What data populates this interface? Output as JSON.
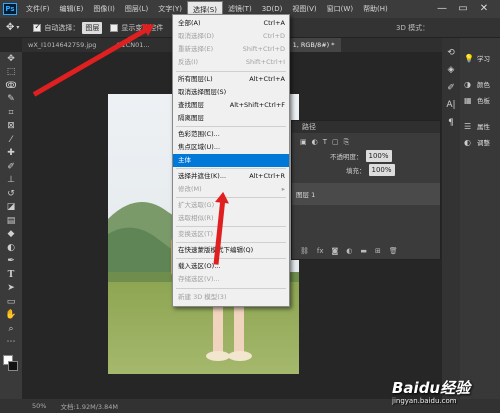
{
  "app_logo": "Ps",
  "menubar": {
    "items": [
      "文件(F)",
      "编辑(E)",
      "图像(I)",
      "图层(L)",
      "文字(Y)",
      "选择(S)",
      "滤镜(T)",
      "3D(D)",
      "视图(V)",
      "窗口(W)",
      "帮助(H)"
    ],
    "active": "选择(S)"
  },
  "window_controls": [
    "—",
    "▭",
    "✕"
  ],
  "options_bar": {
    "auto_select_label": "自动选择：",
    "auto_select_value": "图层",
    "show_transform_label": "显示变换控件",
    "right_icon_label": "3D 模式："
  },
  "tabs": [
    "wX_I1014642759.jpg",
    "O1CN01...",
    "图层 1, RGB/8#) *"
  ],
  "dropdown_menu": {
    "items": [
      {
        "label": "全部(A)",
        "shortcut": "Ctrl+A",
        "enabled": true
      },
      {
        "label": "取消选择(D)",
        "shortcut": "Ctrl+D",
        "enabled": false
      },
      {
        "label": "重新选择(E)",
        "shortcut": "Shift+Ctrl+D",
        "enabled": false
      },
      {
        "label": "反选(I)",
        "shortcut": "Shift+Ctrl+I",
        "enabled": false
      },
      {
        "label": "所有图层(L)",
        "shortcut": "Alt+Ctrl+A",
        "enabled": true
      },
      {
        "label": "取消选择图层(S)",
        "shortcut": "",
        "enabled": true
      },
      {
        "label": "查找图层",
        "shortcut": "Alt+Shift+Ctrl+F",
        "enabled": true
      },
      {
        "label": "隔离图层",
        "shortcut": "",
        "enabled": true
      },
      {
        "label": "色彩范围(C)...",
        "shortcut": "",
        "enabled": true
      },
      {
        "label": "焦点区域(U)...",
        "shortcut": "",
        "enabled": true
      },
      {
        "label": "主体",
        "shortcut": "",
        "enabled": true,
        "highlighted": true
      },
      {
        "label": "选择并遮住(K)...",
        "shortcut": "Alt+Ctrl+R",
        "enabled": true
      },
      {
        "label": "修改(M)",
        "shortcut": "▸",
        "enabled": false
      },
      {
        "label": "扩大选取(G)",
        "shortcut": "",
        "enabled": false
      },
      {
        "label": "选取相似(R)",
        "shortcut": "",
        "enabled": false
      },
      {
        "label": "变换选区(T)",
        "shortcut": "",
        "enabled": false
      },
      {
        "label": "在快速蒙版模式下编辑(Q)",
        "shortcut": "",
        "enabled": true
      },
      {
        "label": "载入选区(O)...",
        "shortcut": "",
        "enabled": true
      },
      {
        "label": "存储选区(V)...",
        "shortcut": "",
        "enabled": false
      },
      {
        "label": "新建 3D 模型(3)",
        "shortcut": "",
        "enabled": false
      }
    ]
  },
  "right_panel": {
    "items": [
      {
        "icon": "learn-icon",
        "label": "学习"
      },
      {
        "icon": "color-icon",
        "label": "颜色"
      },
      {
        "icon": "swatches-icon",
        "label": "色板"
      },
      {
        "icon": "properties-icon",
        "label": "属性"
      },
      {
        "icon": "adjustments-icon",
        "label": "调整"
      }
    ]
  },
  "layers_panel": {
    "tab_label": "路径",
    "opacity_label": "不透明度：",
    "opacity_value": "100%",
    "fill_label": "填充：",
    "fill_value": "100%",
    "layer_name": "图层 1"
  },
  "status_bar": {
    "zoom": "50%",
    "doc_info": "文档:1.92M/3.84M"
  },
  "watermark": {
    "brand": "Baidu经验",
    "url": "jingyan.baidu.com"
  },
  "colors": {
    "highlight": "#0078d7",
    "arrow": "#e02020",
    "ps_blue": "#31a8ff"
  }
}
